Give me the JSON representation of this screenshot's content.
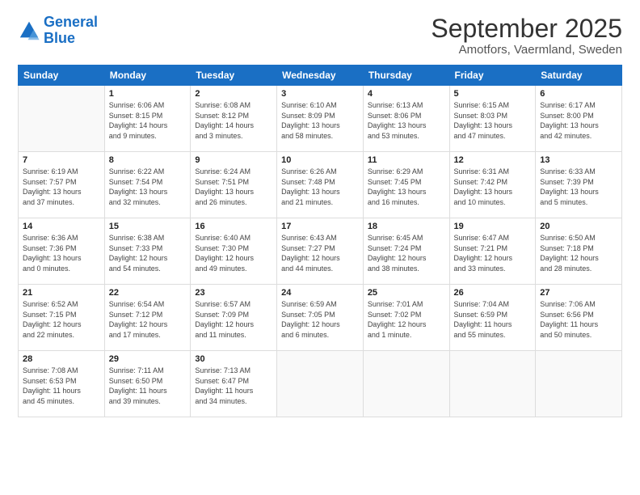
{
  "header": {
    "logo_line1": "General",
    "logo_line2": "Blue",
    "main_title": "September 2025",
    "subtitle": "Amotfors, Vaermland, Sweden"
  },
  "weekdays": [
    "Sunday",
    "Monday",
    "Tuesday",
    "Wednesday",
    "Thursday",
    "Friday",
    "Saturday"
  ],
  "weeks": [
    [
      {
        "day": "",
        "info": ""
      },
      {
        "day": "1",
        "info": "Sunrise: 6:06 AM\nSunset: 8:15 PM\nDaylight: 14 hours\nand 9 minutes."
      },
      {
        "day": "2",
        "info": "Sunrise: 6:08 AM\nSunset: 8:12 PM\nDaylight: 14 hours\nand 3 minutes."
      },
      {
        "day": "3",
        "info": "Sunrise: 6:10 AM\nSunset: 8:09 PM\nDaylight: 13 hours\nand 58 minutes."
      },
      {
        "day": "4",
        "info": "Sunrise: 6:13 AM\nSunset: 8:06 PM\nDaylight: 13 hours\nand 53 minutes."
      },
      {
        "day": "5",
        "info": "Sunrise: 6:15 AM\nSunset: 8:03 PM\nDaylight: 13 hours\nand 47 minutes."
      },
      {
        "day": "6",
        "info": "Sunrise: 6:17 AM\nSunset: 8:00 PM\nDaylight: 13 hours\nand 42 minutes."
      }
    ],
    [
      {
        "day": "7",
        "info": "Sunrise: 6:19 AM\nSunset: 7:57 PM\nDaylight: 13 hours\nand 37 minutes."
      },
      {
        "day": "8",
        "info": "Sunrise: 6:22 AM\nSunset: 7:54 PM\nDaylight: 13 hours\nand 32 minutes."
      },
      {
        "day": "9",
        "info": "Sunrise: 6:24 AM\nSunset: 7:51 PM\nDaylight: 13 hours\nand 26 minutes."
      },
      {
        "day": "10",
        "info": "Sunrise: 6:26 AM\nSunset: 7:48 PM\nDaylight: 13 hours\nand 21 minutes."
      },
      {
        "day": "11",
        "info": "Sunrise: 6:29 AM\nSunset: 7:45 PM\nDaylight: 13 hours\nand 16 minutes."
      },
      {
        "day": "12",
        "info": "Sunrise: 6:31 AM\nSunset: 7:42 PM\nDaylight: 13 hours\nand 10 minutes."
      },
      {
        "day": "13",
        "info": "Sunrise: 6:33 AM\nSunset: 7:39 PM\nDaylight: 13 hours\nand 5 minutes."
      }
    ],
    [
      {
        "day": "14",
        "info": "Sunrise: 6:36 AM\nSunset: 7:36 PM\nDaylight: 13 hours\nand 0 minutes."
      },
      {
        "day": "15",
        "info": "Sunrise: 6:38 AM\nSunset: 7:33 PM\nDaylight: 12 hours\nand 54 minutes."
      },
      {
        "day": "16",
        "info": "Sunrise: 6:40 AM\nSunset: 7:30 PM\nDaylight: 12 hours\nand 49 minutes."
      },
      {
        "day": "17",
        "info": "Sunrise: 6:43 AM\nSunset: 7:27 PM\nDaylight: 12 hours\nand 44 minutes."
      },
      {
        "day": "18",
        "info": "Sunrise: 6:45 AM\nSunset: 7:24 PM\nDaylight: 12 hours\nand 38 minutes."
      },
      {
        "day": "19",
        "info": "Sunrise: 6:47 AM\nSunset: 7:21 PM\nDaylight: 12 hours\nand 33 minutes."
      },
      {
        "day": "20",
        "info": "Sunrise: 6:50 AM\nSunset: 7:18 PM\nDaylight: 12 hours\nand 28 minutes."
      }
    ],
    [
      {
        "day": "21",
        "info": "Sunrise: 6:52 AM\nSunset: 7:15 PM\nDaylight: 12 hours\nand 22 minutes."
      },
      {
        "day": "22",
        "info": "Sunrise: 6:54 AM\nSunset: 7:12 PM\nDaylight: 12 hours\nand 17 minutes."
      },
      {
        "day": "23",
        "info": "Sunrise: 6:57 AM\nSunset: 7:09 PM\nDaylight: 12 hours\nand 11 minutes."
      },
      {
        "day": "24",
        "info": "Sunrise: 6:59 AM\nSunset: 7:05 PM\nDaylight: 12 hours\nand 6 minutes."
      },
      {
        "day": "25",
        "info": "Sunrise: 7:01 AM\nSunset: 7:02 PM\nDaylight: 12 hours\nand 1 minute."
      },
      {
        "day": "26",
        "info": "Sunrise: 7:04 AM\nSunset: 6:59 PM\nDaylight: 11 hours\nand 55 minutes."
      },
      {
        "day": "27",
        "info": "Sunrise: 7:06 AM\nSunset: 6:56 PM\nDaylight: 11 hours\nand 50 minutes."
      }
    ],
    [
      {
        "day": "28",
        "info": "Sunrise: 7:08 AM\nSunset: 6:53 PM\nDaylight: 11 hours\nand 45 minutes."
      },
      {
        "day": "29",
        "info": "Sunrise: 7:11 AM\nSunset: 6:50 PM\nDaylight: 11 hours\nand 39 minutes."
      },
      {
        "day": "30",
        "info": "Sunrise: 7:13 AM\nSunset: 6:47 PM\nDaylight: 11 hours\nand 34 minutes."
      },
      {
        "day": "",
        "info": ""
      },
      {
        "day": "",
        "info": ""
      },
      {
        "day": "",
        "info": ""
      },
      {
        "day": "",
        "info": ""
      }
    ]
  ]
}
